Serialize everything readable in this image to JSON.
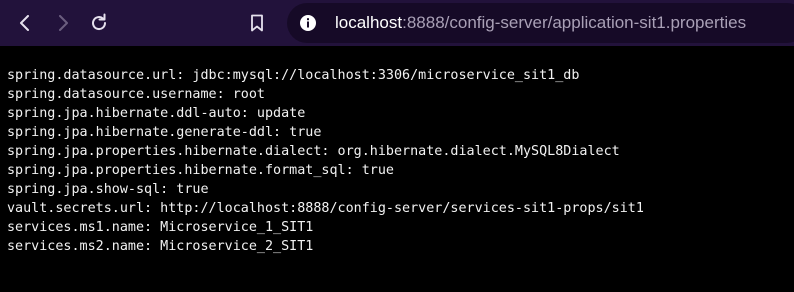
{
  "browser": {
    "url_host": "localhost",
    "url_rest": ":8888/config-server/application-sit1.properties",
    "icons": {
      "back": "arrow-left-icon",
      "forward": "arrow-right-icon",
      "reload": "reload-icon",
      "bookmark": "bookmark-icon",
      "site_info": "info-icon"
    },
    "colors": {
      "toolbar": "#22123b",
      "omnibox": "#160a27",
      "page_background": "#000000",
      "page_text": "#f2f2f2"
    }
  },
  "page": {
    "lines": [
      "spring.datasource.url: jdbc:mysql://localhost:3306/microservice_sit1_db",
      "spring.datasource.username: root",
      "spring.jpa.hibernate.ddl-auto: update",
      "spring.jpa.hibernate.generate-ddl: true",
      "spring.jpa.properties.hibernate.dialect: org.hibernate.dialect.MySQL8Dialect",
      "spring.jpa.properties.hibernate.format_sql: true",
      "spring.jpa.show-sql: true",
      "vault.secrets.url: http://localhost:8888/config-server/services-sit1-props/sit1",
      "services.ms1.name: Microservice_1_SIT1",
      "services.ms2.name: Microservice_2_SIT1"
    ]
  }
}
